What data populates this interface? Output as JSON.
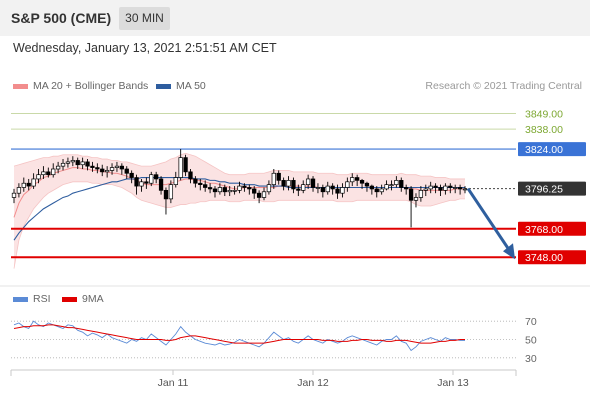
{
  "header": {
    "title": "S&P 500 (CME)",
    "timeframe": "30 MIN"
  },
  "timestamp": "Wednesday, January 13, 2021 2:51:51 AM CET",
  "legend": {
    "bollinger_label": "MA 20 + Bollinger Bands",
    "ma50_label": "MA 50",
    "rsi_label": "RSI",
    "rsi_ma_label": "9MA"
  },
  "credit": "Research © 2021 Trading Central",
  "colors": {
    "bollinger": "#f28d8d",
    "ma50": "#2e5d9f",
    "rsi": "#5b8bd6",
    "rsi_ma": "#e00000",
    "resistance": "#7da832",
    "pivot": "#3a73d6",
    "support": "#e00000",
    "current": "#333333",
    "candle": "#000000"
  },
  "chart_data": [
    {
      "type": "candlestick",
      "ylim": [
        3732,
        3862
      ],
      "current_price": 3796.25,
      "levels": [
        {
          "value": 3849.0,
          "label": "3849.00",
          "kind": "resistance"
        },
        {
          "value": 3838.0,
          "label": "3838.00",
          "kind": "resistance"
        },
        {
          "value": 3824.0,
          "label": "3824.00",
          "kind": "pivot"
        },
        {
          "value": 3796.25,
          "label": "3796.25",
          "kind": "current"
        },
        {
          "value": 3768.0,
          "label": "3768.00",
          "kind": "support"
        },
        {
          "value": 3748.0,
          "label": "3748.00",
          "kind": "support"
        }
      ],
      "x_ticks": [
        "Jan 11",
        "Jan 12",
        "Jan 13"
      ],
      "forecast_arrow": {
        "from": 3796.25,
        "to": 3748.0
      },
      "close": [
        3793,
        3797,
        3800,
        3798,
        3803,
        3806,
        3808,
        3806,
        3810,
        3812,
        3814,
        3815,
        3816,
        3813,
        3815,
        3812,
        3811,
        3810,
        3808,
        3809,
        3811,
        3812,
        3810,
        3807,
        3804,
        3798,
        3801,
        3800,
        3806,
        3803,
        3795,
        3789,
        3799,
        3804,
        3818,
        3808,
        3803,
        3800,
        3799,
        3797,
        3796,
        3794,
        3797,
        3794,
        3795,
        3795,
        3798,
        3797,
        3796,
        3793,
        3790,
        3794,
        3799,
        3807,
        3802,
        3798,
        3802,
        3796,
        3795,
        3799,
        3803,
        3797,
        3797,
        3794,
        3798,
        3796,
        3793,
        3797,
        3801,
        3804,
        3802,
        3800,
        3798,
        3796,
        3794,
        3796,
        3799,
        3799,
        3802,
        3797,
        3796,
        3788,
        3790,
        3795,
        3796,
        3798,
        3797,
        3795,
        3798,
        3797,
        3797,
        3796,
        3796
      ],
      "open": [
        3790,
        3793,
        3797,
        3800,
        3798,
        3803,
        3806,
        3808,
        3806,
        3810,
        3812,
        3814,
        3815,
        3816,
        3813,
        3815,
        3812,
        3811,
        3810,
        3808,
        3809,
        3811,
        3812,
        3810,
        3807,
        3804,
        3798,
        3801,
        3800,
        3806,
        3803,
        3795,
        3789,
        3799,
        3804,
        3818,
        3808,
        3803,
        3800,
        3799,
        3797,
        3796,
        3794,
        3797,
        3794,
        3795,
        3795,
        3798,
        3797,
        3796,
        3793,
        3790,
        3794,
        3799,
        3807,
        3802,
        3798,
        3802,
        3796,
        3795,
        3799,
        3803,
        3797,
        3797,
        3794,
        3798,
        3796,
        3793,
        3797,
        3801,
        3804,
        3802,
        3800,
        3798,
        3796,
        3794,
        3796,
        3799,
        3799,
        3802,
        3797,
        3796,
        3788,
        3790,
        3795,
        3796,
        3798,
        3797,
        3795,
        3798,
        3797,
        3797,
        3796
      ],
      "high": [
        3796,
        3800,
        3804,
        3803,
        3807,
        3810,
        3812,
        3811,
        3814,
        3815,
        3817,
        3818,
        3819,
        3818,
        3818,
        3817,
        3815,
        3814,
        3813,
        3812,
        3814,
        3815,
        3814,
        3812,
        3809,
        3806,
        3803,
        3804,
        3808,
        3808,
        3805,
        3797,
        3802,
        3808,
        3824,
        3820,
        3810,
        3805,
        3803,
        3802,
        3800,
        3798,
        3800,
        3799,
        3798,
        3798,
        3801,
        3800,
        3799,
        3798,
        3795,
        3797,
        3802,
        3810,
        3809,
        3804,
        3805,
        3804,
        3799,
        3802,
        3806,
        3805,
        3800,
        3799,
        3801,
        3800,
        3799,
        3800,
        3804,
        3807,
        3806,
        3803,
        3801,
        3799,
        3798,
        3799,
        3802,
        3802,
        3805,
        3804,
        3799,
        3798,
        3793,
        3798,
        3799,
        3801,
        3800,
        3799,
        3800,
        3800,
        3799,
        3799,
        3798
      ],
      "low": [
        3786,
        3790,
        3794,
        3795,
        3796,
        3800,
        3803,
        3804,
        3804,
        3807,
        3809,
        3811,
        3812,
        3810,
        3810,
        3809,
        3808,
        3807,
        3805,
        3804,
        3806,
        3808,
        3806,
        3803,
        3800,
        3792,
        3794,
        3796,
        3798,
        3800,
        3792,
        3778,
        3786,
        3797,
        3802,
        3805,
        3800,
        3797,
        3795,
        3794,
        3793,
        3790,
        3792,
        3791,
        3791,
        3792,
        3793,
        3794,
        3792,
        3789,
        3786,
        3788,
        3792,
        3796,
        3799,
        3795,
        3795,
        3793,
        3791,
        3793,
        3796,
        3794,
        3793,
        3790,
        3792,
        3792,
        3789,
        3790,
        3794,
        3798,
        3798,
        3796,
        3794,
        3792,
        3790,
        3792,
        3795,
        3795,
        3797,
        3794,
        3792,
        3769,
        3783,
        3787,
        3791,
        3793,
        3793,
        3791,
        3792,
        3793,
        3793,
        3792,
        3793
      ],
      "bollinger_upper": [
        3812,
        3813,
        3814,
        3815,
        3816,
        3817,
        3818,
        3818,
        3819,
        3819,
        3820,
        3820,
        3820,
        3820,
        3819,
        3819,
        3818,
        3818,
        3817,
        3817,
        3816,
        3816,
        3815,
        3815,
        3814,
        3813,
        3812,
        3812,
        3812,
        3813,
        3814,
        3815,
        3817,
        3818,
        3820,
        3821,
        3820,
        3819,
        3817,
        3815,
        3813,
        3811,
        3809,
        3807,
        3806,
        3806,
        3806,
        3806,
        3807,
        3807,
        3807,
        3807,
        3808,
        3809,
        3809,
        3809,
        3809,
        3808,
        3808,
        3808,
        3808,
        3808,
        3807,
        3807,
        3807,
        3807,
        3806,
        3806,
        3806,
        3807,
        3807,
        3807,
        3807,
        3806,
        3806,
        3806,
        3806,
        3806,
        3806,
        3807,
        3806,
        3806,
        3806,
        3805,
        3805,
        3805,
        3804,
        3804,
        3804,
        3803,
        3803,
        3803,
        3803
      ],
      "bollinger_lower": [
        3740,
        3760,
        3770,
        3776,
        3782,
        3786,
        3790,
        3793,
        3795,
        3797,
        3799,
        3800,
        3801,
        3801,
        3801,
        3801,
        3800,
        3800,
        3799,
        3799,
        3799,
        3798,
        3797,
        3795,
        3793,
        3790,
        3788,
        3787,
        3786,
        3785,
        3784,
        3783,
        3783,
        3784,
        3785,
        3785,
        3786,
        3786,
        3787,
        3787,
        3788,
        3788,
        3788,
        3788,
        3787,
        3787,
        3787,
        3788,
        3788,
        3788,
        3788,
        3787,
        3787,
        3787,
        3788,
        3788,
        3788,
        3788,
        3788,
        3788,
        3788,
        3788,
        3788,
        3788,
        3788,
        3788,
        3787,
        3787,
        3787,
        3787,
        3788,
        3788,
        3788,
        3788,
        3788,
        3788,
        3788,
        3788,
        3788,
        3788,
        3788,
        3787,
        3785,
        3784,
        3784,
        3784,
        3785,
        3786,
        3787,
        3788,
        3788,
        3789,
        3789
      ],
      "ma20": [
        3776,
        3786,
        3792,
        3795,
        3799,
        3801,
        3804,
        3805,
        3807,
        3808,
        3809,
        3810,
        3811,
        3811,
        3810,
        3810,
        3809,
        3809,
        3808,
        3808,
        3807,
        3807,
        3806,
        3805,
        3803,
        3802,
        3800,
        3799,
        3799,
        3799,
        3799,
        3799,
        3800,
        3801,
        3802,
        3803,
        3803,
        3802,
        3802,
        3801,
        3800,
        3800,
        3799,
        3798,
        3797,
        3796,
        3796,
        3797,
        3797,
        3797,
        3797,
        3797,
        3797,
        3797,
        3798,
        3798,
        3798,
        3798,
        3798,
        3798,
        3798,
        3798,
        3797,
        3797,
        3797,
        3797,
        3797,
        3797,
        3797,
        3797,
        3797,
        3797,
        3797,
        3797,
        3797,
        3797,
        3797,
        3797,
        3797,
        3797,
        3797,
        3796,
        3796,
        3795,
        3795,
        3795,
        3795,
        3795,
        3795,
        3795,
        3796,
        3796,
        3796
      ],
      "ma50": [
        3760,
        3765,
        3769,
        3773,
        3776,
        3779,
        3782,
        3784,
        3786,
        3788,
        3790,
        3791,
        3793,
        3794,
        3795,
        3796,
        3797,
        3798,
        3799,
        3800,
        3801,
        3801,
        3802,
        3803,
        3803,
        3803,
        3804,
        3804,
        3804,
        3804,
        3804,
        3804,
        3804,
        3804,
        3804,
        3804,
        3804,
        3803,
        3803,
        3803,
        3802,
        3802,
        3801,
        3801,
        3800,
        3800,
        3800,
        3799,
        3799,
        3799,
        3798,
        3798,
        3798,
        3798,
        3798,
        3798,
        3797,
        3797,
        3797,
        3797,
        3797,
        3797,
        3797,
        3797,
        3797,
        3797,
        3797,
        3797,
        3797,
        3797,
        3797,
        3797,
        3797,
        3797,
        3797,
        3797,
        3797,
        3797,
        3797,
        3797,
        3797,
        3797,
        3797,
        3797,
        3797,
        3797,
        3797,
        3797,
        3797,
        3797,
        3797,
        3797,
        3797
      ]
    },
    {
      "type": "line",
      "ylim": [
        20,
        80
      ],
      "y_ticks": [
        "70",
        "50",
        "30"
      ],
      "series": [
        {
          "name": "RSI",
          "values": [
            66,
            68,
            64,
            62,
            70,
            66,
            64,
            68,
            66,
            64,
            62,
            66,
            65,
            60,
            58,
            54,
            57,
            55,
            52,
            56,
            52,
            50,
            48,
            46,
            50,
            48,
            52,
            50,
            56,
            52,
            48,
            44,
            50,
            56,
            64,
            58,
            54,
            50,
            48,
            46,
            45,
            44,
            46,
            44,
            45,
            47,
            50,
            48,
            46,
            44,
            42,
            46,
            52,
            58,
            54,
            50,
            52,
            48,
            46,
            50,
            54,
            50,
            48,
            46,
            50,
            48,
            46,
            48,
            52,
            54,
            52,
            50,
            48,
            46,
            44,
            48,
            50,
            50,
            54,
            48,
            46,
            38,
            42,
            48,
            50,
            52,
            50,
            48,
            52,
            50,
            50,
            49,
            49
          ]
        },
        {
          "name": "9MA",
          "values": [
            62,
            63,
            64,
            64,
            65,
            65,
            65,
            66,
            66,
            65,
            64,
            63,
            63,
            62,
            61,
            60,
            59,
            58,
            57,
            56,
            55,
            54,
            53,
            52,
            51,
            50,
            50,
            50,
            50,
            50,
            50,
            49,
            49,
            50,
            52,
            53,
            54,
            54,
            53,
            52,
            51,
            50,
            49,
            48,
            47,
            46,
            46,
            46,
            46,
            46,
            46,
            46,
            47,
            48,
            49,
            50,
            50,
            50,
            50,
            50,
            50,
            50,
            50,
            49,
            49,
            49,
            48,
            48,
            48,
            49,
            49,
            50,
            50,
            49,
            49,
            49,
            48,
            48,
            49,
            49,
            49,
            48,
            47,
            46,
            46,
            46,
            47,
            48,
            48,
            49,
            49,
            50,
            50
          ]
        }
      ]
    }
  ]
}
